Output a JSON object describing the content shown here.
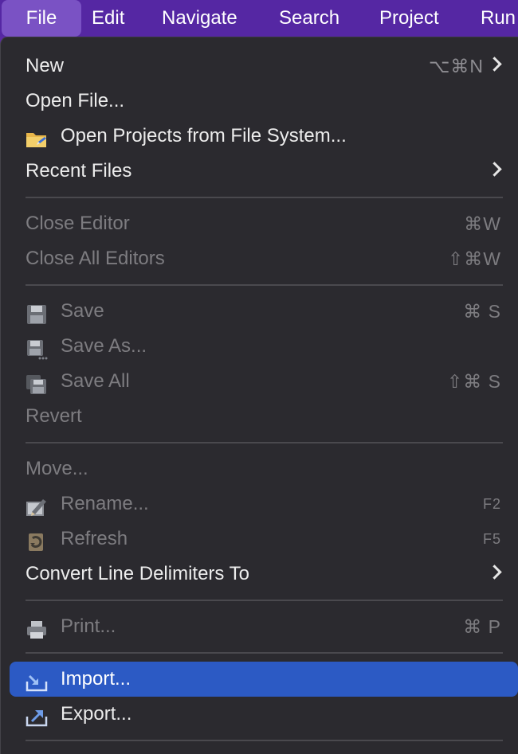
{
  "menubar": {
    "items": [
      "File",
      "Edit",
      "Navigate",
      "Search",
      "Project",
      "Run"
    ]
  },
  "menu": {
    "new": {
      "label": "New",
      "shortcut": "⌥⌘N"
    },
    "open_file": {
      "label": "Open File..."
    },
    "open_projects": {
      "label": "Open Projects from File System..."
    },
    "recent_files": {
      "label": "Recent Files"
    },
    "close_editor": {
      "label": "Close Editor",
      "shortcut": "⌘W"
    },
    "close_all_editors": {
      "label": "Close All Editors",
      "shortcut": "⇧⌘W"
    },
    "save": {
      "label": "Save",
      "shortcut": "⌘ S"
    },
    "save_as": {
      "label": "Save As..."
    },
    "save_all": {
      "label": "Save All",
      "shortcut": "⇧⌘ S"
    },
    "revert": {
      "label": "Revert"
    },
    "move": {
      "label": "Move..."
    },
    "rename": {
      "label": "Rename...",
      "shortcut": "F2"
    },
    "refresh": {
      "label": "Refresh",
      "shortcut": "F5"
    },
    "convert_line_delimiters": {
      "label": "Convert Line Delimiters To"
    },
    "print": {
      "label": "Print...",
      "shortcut": "⌘ P"
    },
    "import": {
      "label": "Import..."
    },
    "export": {
      "label": "Export..."
    }
  },
  "colors": {
    "menubar_bg": "#5527a3",
    "menu_bg": "#2b2a2f",
    "highlight": "#2c5ac4",
    "disabled_text": "#7d7c80"
  }
}
